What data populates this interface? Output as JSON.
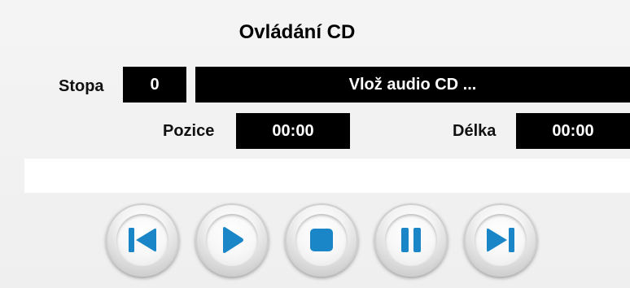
{
  "title": "Ovládání CD",
  "track": {
    "label": "Stopa",
    "value": "0",
    "status": "Vlož audio CD ..."
  },
  "position": {
    "label": "Pozice",
    "value": "00:00"
  },
  "length": {
    "label": "Délka",
    "value": "00:00"
  },
  "progress": {
    "fraction": 0
  },
  "controls": [
    {
      "name": "previous",
      "icon": "skip-previous-icon"
    },
    {
      "name": "play",
      "icon": "play-icon"
    },
    {
      "name": "stop",
      "icon": "stop-icon"
    },
    {
      "name": "pause",
      "icon": "pause-icon"
    },
    {
      "name": "next",
      "icon": "skip-next-icon"
    }
  ],
  "colors": {
    "accent": "#1a86c8",
    "display_bg": "#000000",
    "display_text": "#ffffff"
  }
}
